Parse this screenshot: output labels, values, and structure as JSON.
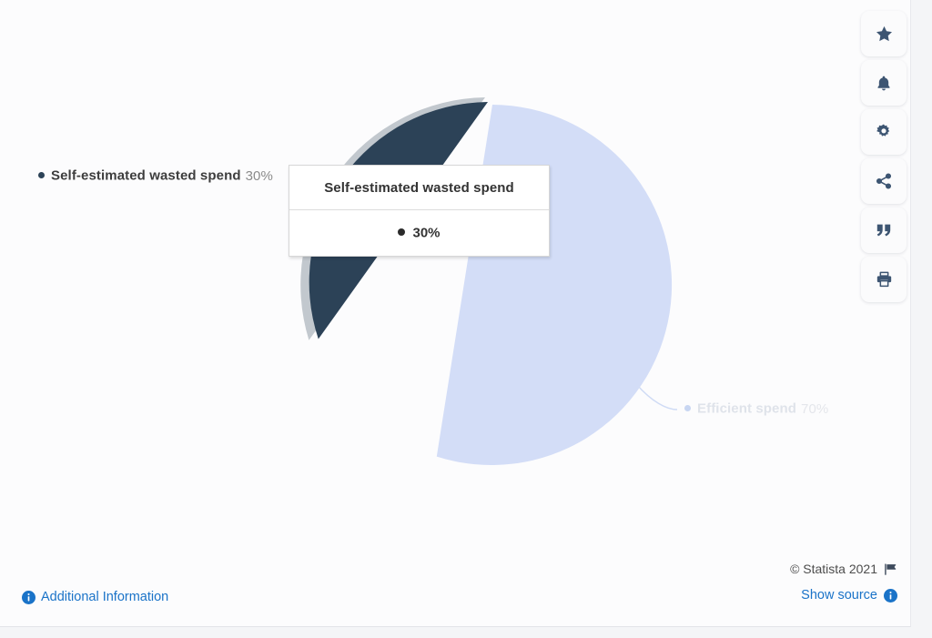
{
  "chart_data": {
    "type": "pie",
    "title": "",
    "categories": [
      "Self-estimated wasted spend",
      "Efficient spend"
    ],
    "values": [
      30,
      70
    ],
    "value_labels": [
      "30%",
      "70%"
    ],
    "colors": [
      "#2c4257",
      "#d3ddf7"
    ],
    "legend_position": "callout-labels",
    "highlighted_slice": "Self-estimated wasted spend",
    "units": "percent"
  },
  "labels": {
    "wasted": {
      "name": "Self-estimated wasted spend",
      "value": "30%"
    },
    "efficient": {
      "name": "Efficient spend",
      "value": "70%"
    }
  },
  "tooltip": {
    "title": "Self-estimated wasted spend",
    "value": "30%"
  },
  "toolbar": {
    "items": [
      {
        "name": "favorite-star",
        "icon": "star-icon"
      },
      {
        "name": "notifications",
        "icon": "bell-icon"
      },
      {
        "name": "settings",
        "icon": "gear-icon"
      },
      {
        "name": "share",
        "icon": "share-icon"
      },
      {
        "name": "cite",
        "icon": "quote-icon"
      },
      {
        "name": "print",
        "icon": "print-icon"
      }
    ]
  },
  "footer": {
    "additional_information": "Additional Information",
    "copyright": "© Statista 2021",
    "show_source": "Show source"
  },
  "theme": {
    "accent_blue": "#1a73c8",
    "slice_dark": "#2c4257",
    "slice_light": "#d3ddf7",
    "halo_grey": "#c2c8ce",
    "page_bg": "#fcfcfd"
  }
}
